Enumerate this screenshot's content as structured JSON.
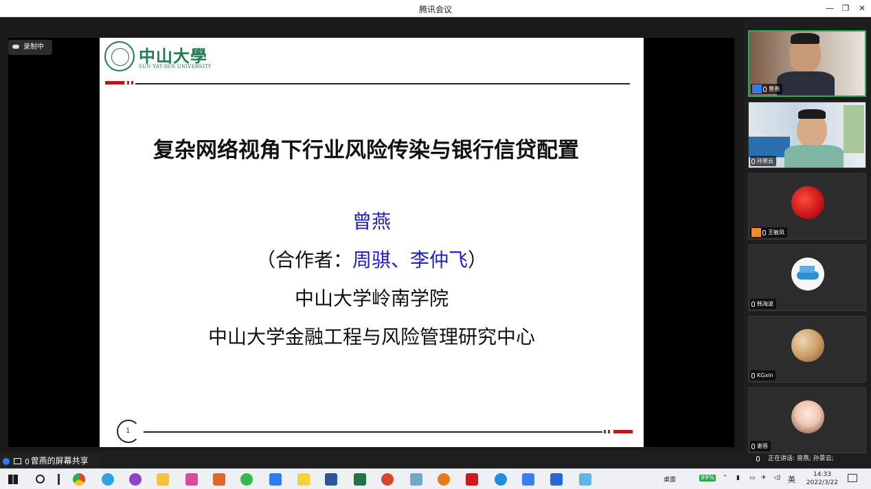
{
  "window": {
    "title": "腾讯会议",
    "minimize": "—",
    "restore": "❐",
    "close": "✕"
  },
  "recording": {
    "label": "录制中"
  },
  "slide": {
    "logo_cn": "中山大學",
    "logo_en": "SUN YAT-SEN UNIVERSITY",
    "title": "复杂网络视角下行业风险传染与银行信贷配置",
    "author": "曾燕",
    "coauthors_prefix": "（合作者：",
    "coauthors_names": "周骐、李仲飞",
    "coauthors_suffix": "）",
    "affiliation_1": "中山大学岭南学院",
    "affiliation_2": "中山大学金融工程与风险管理研究中心",
    "page_number": "1"
  },
  "participants": [
    {
      "name": "曾燕"
    },
    {
      "name": "孙景云"
    },
    {
      "name": "王敏凤"
    },
    {
      "name": "韩海波"
    },
    {
      "name": "KGxin"
    },
    {
      "name": "谢晋"
    }
  ],
  "share_status": "曾燕的屏幕共享",
  "speaking_status": "正在讲话: 曾燕; 孙景云;",
  "taskbar": {
    "desktop_label": "桌面",
    "battery": "99%",
    "ime": "英",
    "time": "14:33",
    "date": "2022/3/22"
  }
}
